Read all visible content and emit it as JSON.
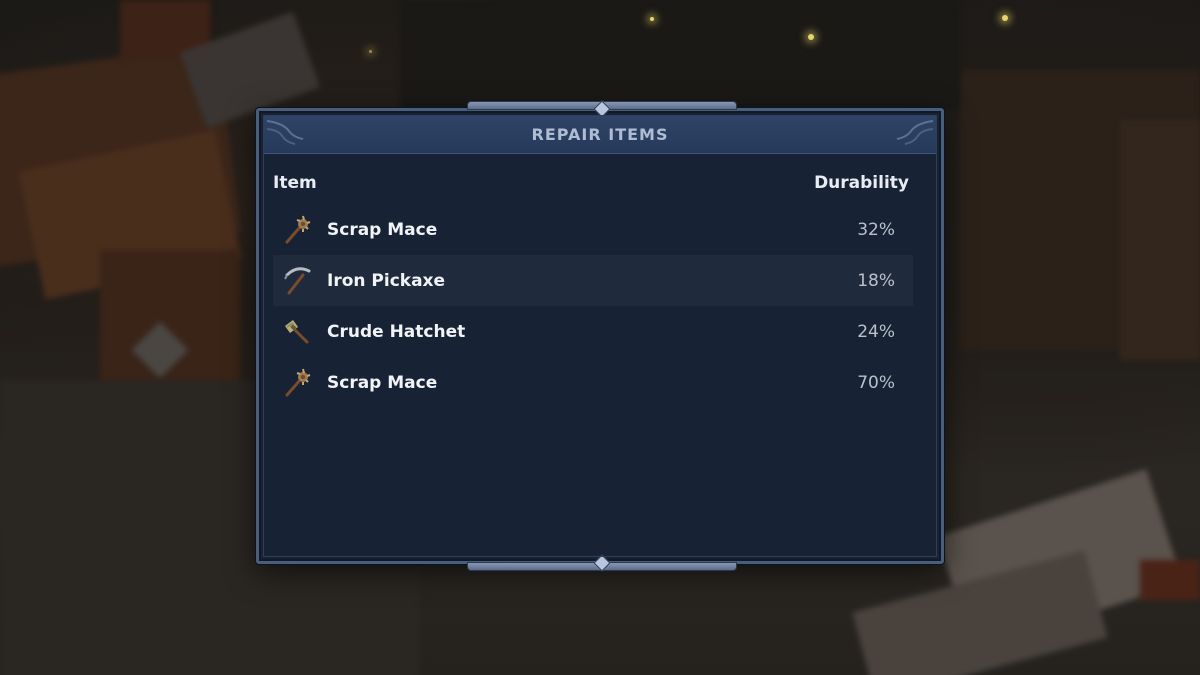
{
  "panel": {
    "title": "REPAIR ITEMS",
    "columns": {
      "item": "Item",
      "durability": "Durability"
    }
  },
  "items": [
    {
      "name": "Scrap Mace",
      "durability": "32%",
      "icon": "mace-icon",
      "selected": false
    },
    {
      "name": "Iron Pickaxe",
      "durability": "18%",
      "icon": "pickaxe-icon",
      "selected": true
    },
    {
      "name": "Crude Hatchet",
      "durability": "24%",
      "icon": "hatchet-icon",
      "selected": false
    },
    {
      "name": "Scrap Mace",
      "durability": "70%",
      "icon": "mace-icon",
      "selected": false
    }
  ],
  "colors": {
    "panel_bg": "#172335",
    "panel_border": "#4a5d7a",
    "title_bar": "#2f4466",
    "title_text": "#aebdd3",
    "selected_row": "#1f2b3d"
  }
}
